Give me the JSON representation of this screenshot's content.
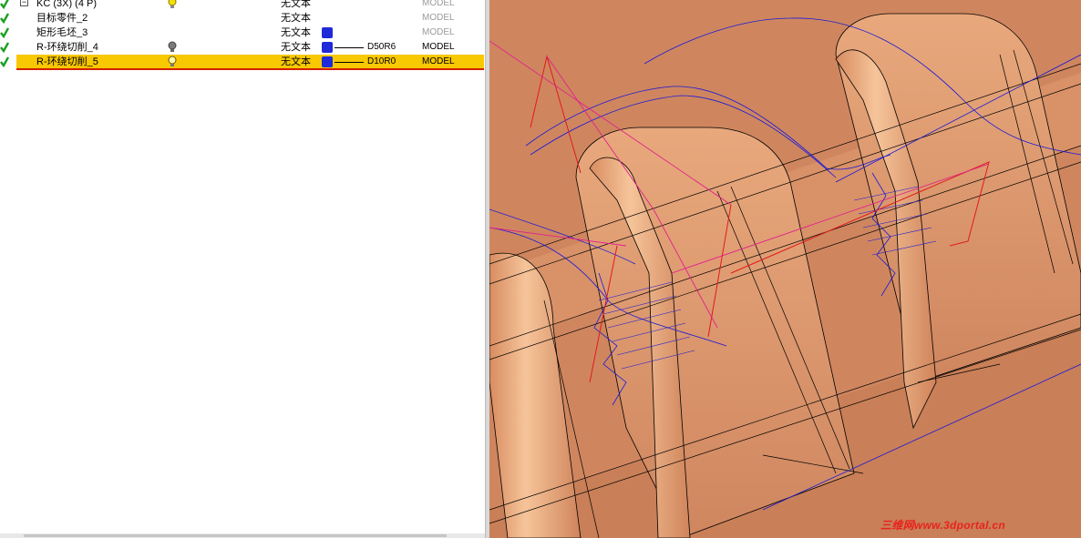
{
  "tree": {
    "rows": [
      {
        "name": "KC (3X) (4 P)",
        "text": "无文本",
        "tool": "",
        "model": "MODEL"
      },
      {
        "name": "目标零件_2",
        "text": "无文本",
        "tool": "",
        "model": "MODEL"
      },
      {
        "name": "矩形毛坯_3",
        "text": "无文本",
        "tool": "",
        "model": "MODEL"
      },
      {
        "name": "R-环绕切削_4",
        "text": "无文本",
        "tool": "D50R6",
        "model": "MODEL"
      },
      {
        "name": "R-环绕切削_5",
        "text": "无文本",
        "tool": "D10R0",
        "model": "MODEL"
      }
    ],
    "expander_symbol": "−"
  },
  "colors": {
    "selection": "#f8c800",
    "swatch": "#1f2ad8",
    "part_surface": "#e0a074",
    "toolpath_blue": "#1a1ad6",
    "toolpath_red": "#e01b1b",
    "toolpath_magenta": "#e0208c"
  },
  "watermark": "三维网www.3dportal.cn"
}
